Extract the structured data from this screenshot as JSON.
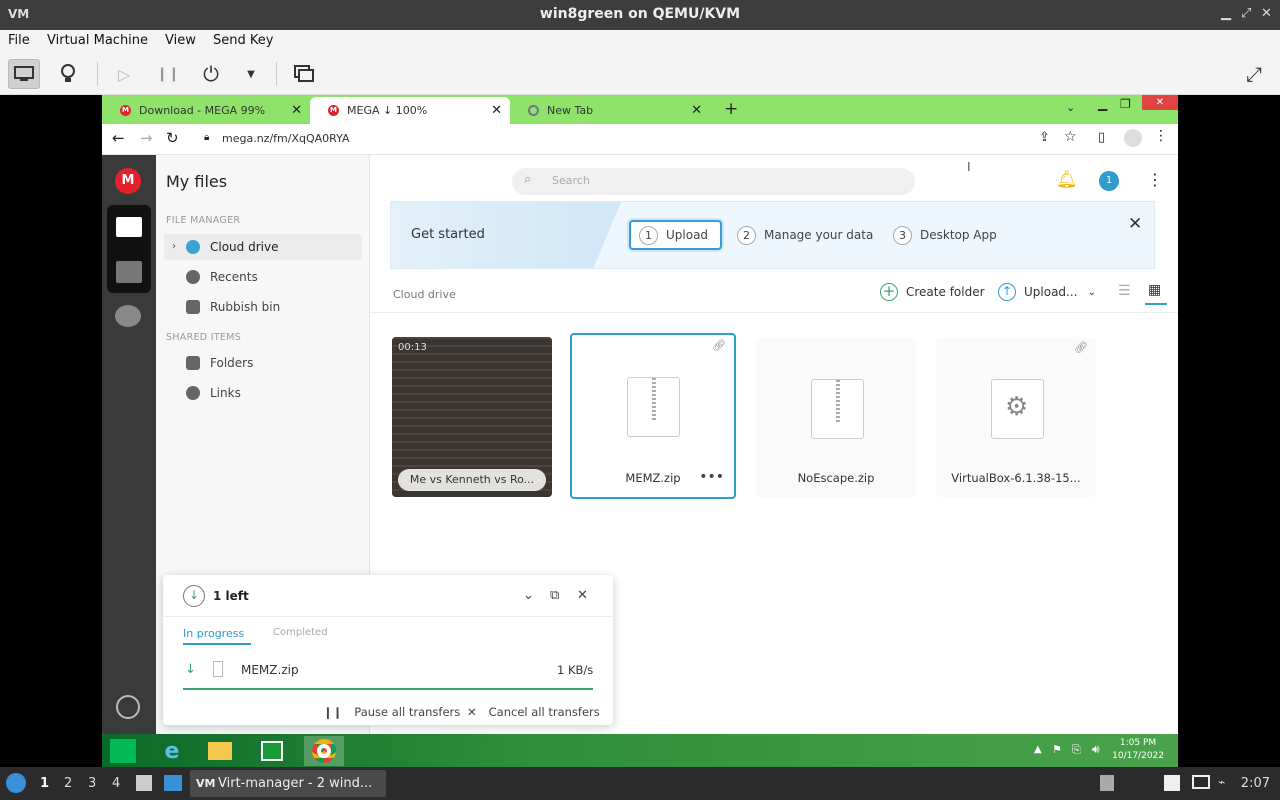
{
  "qemu": {
    "title": "win8green on QEMU/KVM",
    "menu": [
      "File",
      "Virtual Machine",
      "View",
      "Send Key"
    ]
  },
  "browser": {
    "tabs": [
      {
        "label": "Download - MEGA 99%"
      },
      {
        "label": "MEGA ↓ 100%"
      },
      {
        "label": "New Tab"
      }
    ],
    "url": "mega.nz/fm/XqQA0RYA"
  },
  "mega": {
    "page_title": "My files",
    "section_file_manager": "FILE MANAGER",
    "section_shared": "SHARED ITEMS",
    "nav": [
      "Cloud drive",
      "Recents",
      "Rubbish bin"
    ],
    "shared_nav": [
      "Folders",
      "Links"
    ],
    "search_placeholder": "Search",
    "notif_count": "1",
    "banner": {
      "title": "Get started",
      "steps": [
        {
          "num": "1",
          "label": "Upload"
        },
        {
          "num": "2",
          "label": "Manage your data"
        },
        {
          "num": "3",
          "label": "Desktop App"
        }
      ]
    },
    "breadcrumb": "Cloud drive",
    "create_folder": "Create folder",
    "upload": "Upload...",
    "files": [
      {
        "name": "Me vs Kenneth vs Ro...",
        "duration": "00:13"
      },
      {
        "name": "MEMZ.zip"
      },
      {
        "name": "NoEscape.zip"
      },
      {
        "name": "VirtualBox-6.1.38-15..."
      }
    ]
  },
  "transfer": {
    "status": "1 left",
    "tab_in_progress": "In progress",
    "tab_completed": "Completed",
    "item_name": "MEMZ.zip",
    "item_speed": "1 KB/s",
    "progress": 1.0,
    "pause_all": "Pause all transfers",
    "cancel_all": "Cancel all transfers"
  },
  "windows": {
    "time": "1:05 PM",
    "date": "10/17/2022"
  },
  "host": {
    "workspaces": [
      "1",
      "2",
      "3",
      "4"
    ],
    "task": "Virt-manager - 2 wind...",
    "time": "2:07"
  },
  "colors": {
    "mega_red": "#d9272e",
    "chrome_green": "#8fe36a",
    "accent_blue": "#2f9ccc",
    "progress_green": "#3aa66a"
  }
}
